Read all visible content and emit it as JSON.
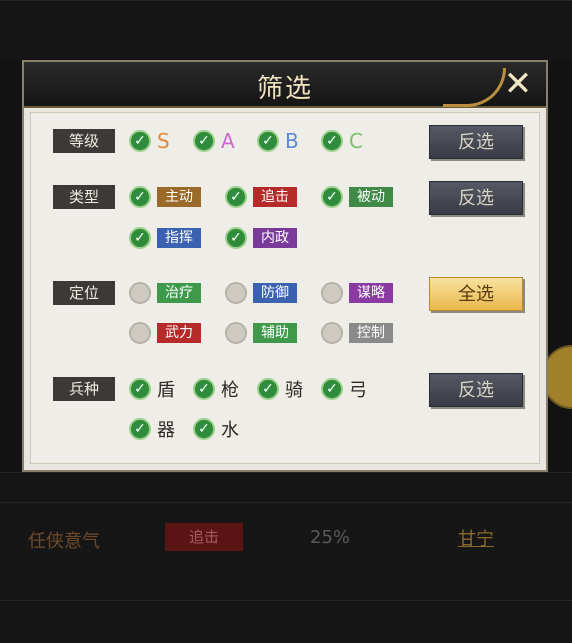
{
  "dialog": {
    "title": "筛选",
    "close_icon": "close-x-icon",
    "panel_color": "#efede7"
  },
  "rows": {
    "grade": {
      "label": "等级",
      "button": "反选",
      "options": [
        {
          "text": "S",
          "checked": true,
          "color": "#e38a3c"
        },
        {
          "text": "A",
          "checked": true,
          "color": "#d068d0"
        },
        {
          "text": "B",
          "checked": true,
          "color": "#5a8ad8"
        },
        {
          "text": "C",
          "checked": true,
          "color": "#7ac26a"
        }
      ]
    },
    "type": {
      "label": "类型",
      "button": "反选",
      "options": [
        {
          "text": "主动",
          "checked": true,
          "color": "#9a6a28"
        },
        {
          "text": "追击",
          "checked": true,
          "color": "#b62a2a"
        },
        {
          "text": "被动",
          "checked": true,
          "color": "#3e8a46"
        },
        {
          "text": "指挥",
          "checked": true,
          "color": "#3a62b0"
        },
        {
          "text": "内政",
          "checked": true,
          "color": "#7a3a9a"
        }
      ]
    },
    "position": {
      "label": "定位",
      "button": "全选",
      "options": [
        {
          "text": "治疗",
          "checked": false,
          "color": "#3e9a4a"
        },
        {
          "text": "防御",
          "checked": false,
          "color": "#3a62b0"
        },
        {
          "text": "谋略",
          "checked": false,
          "color": "#8a3aa0"
        },
        {
          "text": "武力",
          "checked": false,
          "color": "#b62a2a"
        },
        {
          "text": "辅助",
          "checked": false,
          "color": "#3e9a4a"
        },
        {
          "text": "控制",
          "checked": false,
          "color": "#8a8a8a"
        }
      ]
    },
    "troop": {
      "label": "兵种",
      "button": "反选",
      "options": [
        {
          "text": "盾",
          "checked": true
        },
        {
          "text": "枪",
          "checked": true
        },
        {
          "text": "骑",
          "checked": true
        },
        {
          "text": "弓",
          "checked": true
        },
        {
          "text": "器",
          "checked": true
        },
        {
          "text": "水",
          "checked": true
        }
      ]
    }
  },
  "background_list": {
    "row": {
      "name": "任侠意气",
      "tag": "追击",
      "percent": "25%",
      "general": "甘宁"
    }
  }
}
